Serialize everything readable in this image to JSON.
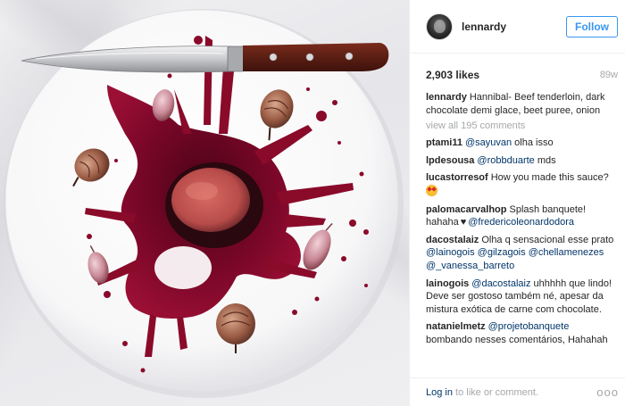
{
  "post": {
    "username": "lennardy",
    "follow_label": "Follow",
    "likes": "2,903 likes",
    "age": "89w",
    "caption_user": "lennardy",
    "caption_text": "Hannibal- Beef tenderloin, dark chocolate demi glace, beet puree, onion",
    "view_all": "view all 195 comments"
  },
  "comments": [
    {
      "user": "ptami11",
      "mention": "@sayuvan",
      "text": "olha isso"
    },
    {
      "user": "lpdesousa",
      "mention": "@robbduarte",
      "text": "mds"
    },
    {
      "user": "lucastorresof",
      "text": "How you made this sauce?"
    },
    {
      "user": "palomacarvalhop",
      "text1": "Splash banquete! hahaha",
      "mention": "@fredericoleonardodora"
    },
    {
      "user": "dacostalaiz",
      "text": "Olha q sensacional esse prato",
      "mentions": [
        "@lainogois",
        "@gilzagois",
        "@chellamenezes",
        "@_vanessa_barreto"
      ]
    },
    {
      "user": "lainogois",
      "mention": "@dacostalaiz",
      "text": "uhhhhh que lindo! Deve ser gostoso também né, apesar da mistura exótica de carne com chocolate."
    },
    {
      "user": "natanielmetz",
      "mention": "@projetobanquete",
      "text": "bombando nesses comentários, Hahahah"
    }
  ],
  "footer": {
    "login_link": "Log in",
    "login_rest": "to like or comment.",
    "more": "ooo"
  },
  "icons": {
    "avatar": "profile-photo",
    "more": "more-options-icon",
    "emoji": "heart-eyes-emoji",
    "heart": "black-heart"
  },
  "colors": {
    "follow_blue": "#3897f0",
    "link": "#003569",
    "muted": "#a5a7aa",
    "sauce": "#8a0a2a"
  }
}
